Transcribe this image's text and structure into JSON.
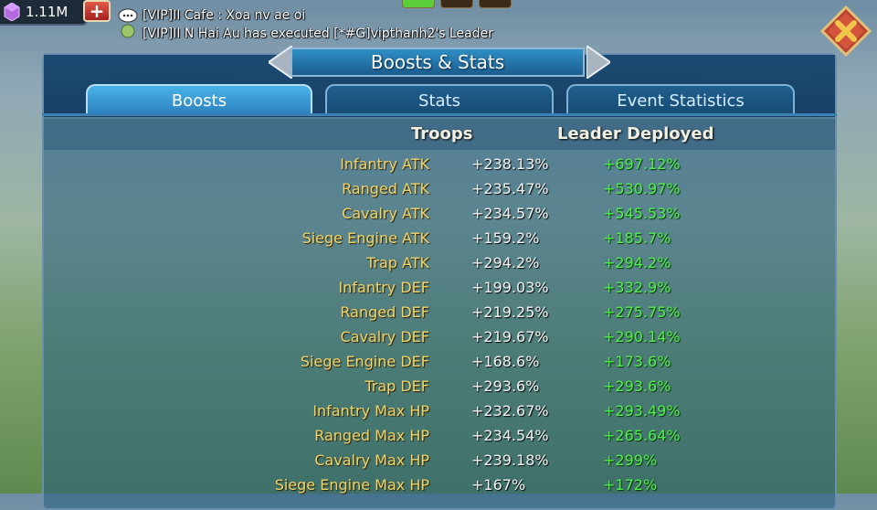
{
  "topbar": {
    "gems": "1.11M",
    "add_label": "+"
  },
  "chat": {
    "line1": "[VIP]II Cafe : Xoa nv ae oi",
    "line2": "[VIP]II N Hai Au has executed [*#G]vipthanh2's Leader"
  },
  "panel": {
    "title": "Boosts & Stats",
    "tabs": [
      "Boosts",
      "Stats",
      "Event Statistics"
    ],
    "active_tab": "Boosts"
  },
  "table": {
    "headers": {
      "troops": "Troops",
      "leader": "Leader Deployed"
    },
    "rows": [
      {
        "name": "Infantry ATK",
        "troops": "+238.13%",
        "leader": "+697.12%"
      },
      {
        "name": "Ranged ATK",
        "troops": "+235.47%",
        "leader": "+530.97%"
      },
      {
        "name": "Cavalry ATK",
        "troops": "+234.57%",
        "leader": "+545.53%"
      },
      {
        "name": "Siege Engine ATK",
        "troops": "+159.2%",
        "leader": "+185.7%"
      },
      {
        "name": "Trap ATK",
        "troops": "+294.2%",
        "leader": "+294.2%"
      },
      {
        "name": "Infantry DEF",
        "troops": "+199.03%",
        "leader": "+332.9%"
      },
      {
        "name": "Ranged DEF",
        "troops": "+219.25%",
        "leader": "+275.75%"
      },
      {
        "name": "Cavalry DEF",
        "troops": "+219.67%",
        "leader": "+290.14%"
      },
      {
        "name": "Siege Engine DEF",
        "troops": "+168.6%",
        "leader": "+173.6%"
      },
      {
        "name": "Trap DEF",
        "troops": "+293.6%",
        "leader": "+293.6%"
      },
      {
        "name": "Infantry Max HP",
        "troops": "+232.67%",
        "leader": "+293.49%"
      },
      {
        "name": "Ranged Max HP",
        "troops": "+234.54%",
        "leader": "+265.64%"
      },
      {
        "name": "Cavalry Max HP",
        "troops": "+239.18%",
        "leader": "+299%"
      },
      {
        "name": "Siege Engine Max HP",
        "troops": "+167%",
        "leader": "+172%"
      }
    ]
  },
  "icons": {
    "gem": "gem-icon",
    "chat": "chat-bubble-icon",
    "close": "close-icon",
    "arrow_left": "arrow-left-icon",
    "arrow_right": "arrow-right-icon"
  },
  "colors": {
    "stat_name": "#f0d56a",
    "troops_value": "#f4f4f4",
    "leader_value": "#4ef04a",
    "tab_active": "#49b3e6"
  }
}
